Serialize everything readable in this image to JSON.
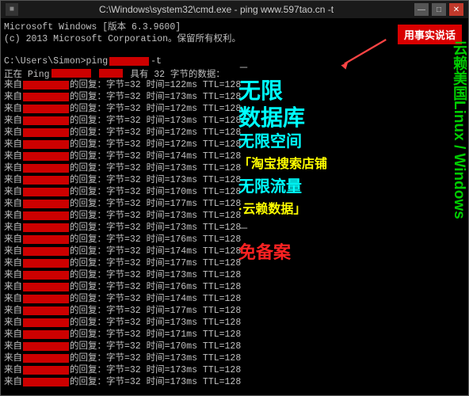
{
  "window": {
    "title": "C:\\Windows\\system32\\cmd.exe - ping  www.597tao.cn -t",
    "icon": "■"
  },
  "controls": {
    "minimize": "—",
    "maximize": "□",
    "close": "✕"
  },
  "console": {
    "line1": "Microsoft Windows [版本 6.3.9600]",
    "line2": "(c) 2013 Microsoft Corporation。保留所有权利。",
    "line3": "",
    "line4_prefix": "C:\\Users\\Simon>ping ",
    "line4_redbar": true,
    "line4_suffix": " -t",
    "ping_header_prefix": "正在 Ping ",
    "ping_header_suffix": " 具有 32 字节的数据：",
    "rows": [
      "来自 198.█.█25.37 的回复：字节=32 时间=122ms TTL=128",
      "来自 198.█.█.37 的回复：字节=32 时间=173ms TTL=128",
      "来自 198.█.█.37 的回复：字节=32 时间=172ms TTL=128",
      "来自 198.█.█.37 的回复：字节=32 时间=173ms TTL=128",
      "来自 198.█.█.37 的回复：字节=32 时间=172ms TTL=128",
      "来自 198.█.█.37 的回复：字节=32 时间=172ms TTL=128",
      "来自 198.█.█.37 的回复：字节=32 时间=174ms TTL=128",
      "来自 198.█.█.37 的回复：字节=32 时间=173ms TTL=128",
      "来自 198.█.█.37 的回复：字节=32 时间=173ms TTL=128",
      "来自 198.█.█.37 的回复：字节=32 时间=170ms TTL=128",
      "来自 198.█.█.37 的回复：字节=32 时间=177ms TTL=128",
      "来自 198.█.█.37 的回复：字节=32 时间=173ms TTL=128",
      "来自 198.█.█.37 的回复：字节=32 时间=173ms TTL=128",
      "来自 198.█.█.37 的回复：字节=32 时间=176ms TTL=128",
      "来自 198.█.█.37 的回复：字节=32 时间=174ms TTL=128",
      "来自 198.█.█.37 的回复：字节=32 时间=177ms TTL=128",
      "来自 198.█.█.37 的回复：字节=32 时间=173ms TTL=128",
      "来自 198.█.█.37 的回复：字节=32 时间=176ms TTL=128",
      "来自 198.█.█.37 的回复：字节=32 时间=174ms TTL=128",
      "来自 198.█.█.37 的回复：字节=32 时间=177ms TTL=128",
      "来自 198.█.█.37 的回复：字节=32 时间=173ms TTL=128",
      "来自 198.█.█.37 的回复：字节=32 时间=171ms TTL=128",
      "来自 198.█.█.37 的回复：字节=32 时间=170ms TTL=128",
      "来自 198.█.█.37 的回复：字节=32 时间=173ms TTL=128",
      "来自 198.█.█.37 的回复：字节=32 时间=173ms TTL=128",
      "来自 198.█.█.37 的回复：字节=32 时间=173ms TTL=128"
    ]
  },
  "overlay": {
    "badge": "用事实说话",
    "text1": "无限",
    "text2": "数据库",
    "text3": "无限空间",
    "text4": "无限流量",
    "text5": "免备案",
    "text6": "云赖美国Linux / Windows",
    "taobao_bracket": "「淘宝搜索店铺",
    "taobao_end": "·云赖数据」",
    "dash1": "－",
    "dash2": "－"
  },
  "colors": {
    "background": "#000000",
    "text_normal": "#c0c0c0",
    "text_cyan": "#00ffff",
    "text_yellow": "#ffff00",
    "text_red": "#ff2222",
    "text_green": "#00aa00",
    "badge_bg": "#cc0000",
    "titlebar_bg": "#1a1a1a"
  }
}
